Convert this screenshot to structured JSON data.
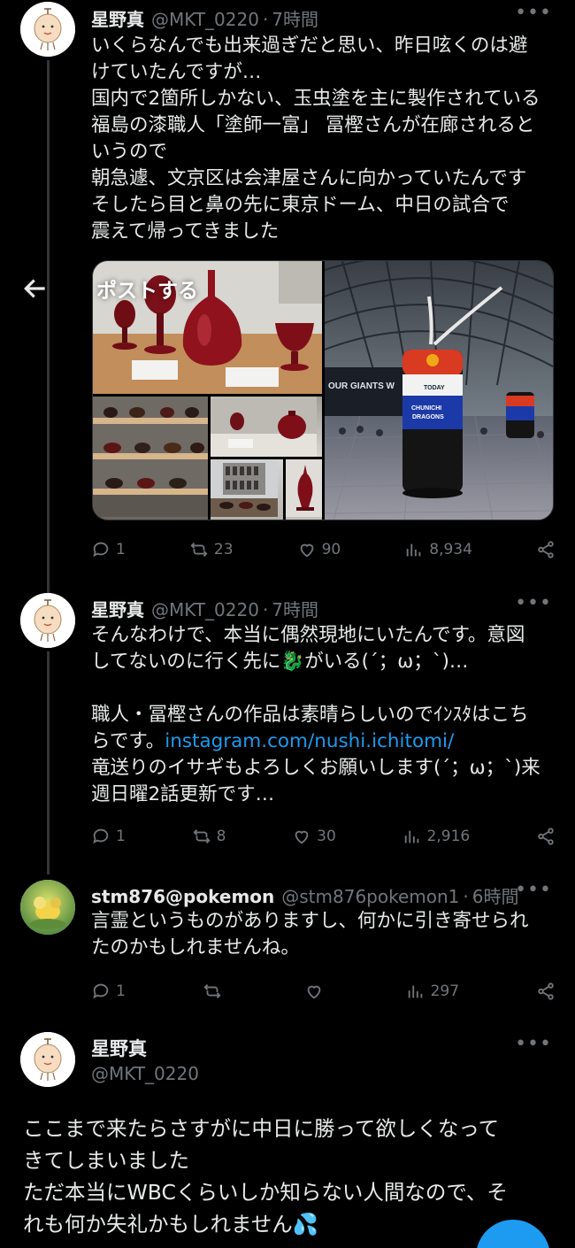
{
  "nav": {
    "back_icon": "arrow-left-icon"
  },
  "tweets": [
    {
      "name": "星野真",
      "handle": "@MKT_0220",
      "time": "7時間",
      "lines": [
        "いくらなんでも出来過ぎだと思い、昨日呟くのは避",
        "けていたんですが…",
        "国内で2箇所しかない、玉虫塗を主に製作されている",
        "福島の漆職人「塗師一富」 冨樫さんが在廊されると",
        "いうので",
        "朝急遽、文京区は会津屋さんに向かっていたんです",
        "そしたら目と鼻の先に東京ドーム、中日の試合で",
        "震えて帰ってきました"
      ],
      "media_overlay": "ポストする",
      "media_texts": {
        "banner": "OUR GIANTS W",
        "pillar_top": "TODAY",
        "pillar_1": "CHUNICHI",
        "pillar_2": "DRAGONS"
      },
      "actions": {
        "replies": "1",
        "reposts": "23",
        "likes": "90",
        "views": "8,934"
      }
    },
    {
      "name": "星野真",
      "handle": "@MKT_0220",
      "time": "7時間",
      "lines": [
        "そんなわけで、本当に偶然現地にいたんです。意図",
        "してないのに行く先に🐉がいる(´；ω；`)…",
        "",
        "職人・冨樫さんの作品は素晴らしいのでｲﾝｽﾀはこち",
        "らです。"
      ],
      "link": "instagram.com/nushi.ichitomi/",
      "lines_after": [
        "竜送りのイサギもよろしくお願いします(´；ω；`)来",
        "週日曜2話更新です…"
      ],
      "actions": {
        "replies": "1",
        "reposts": "8",
        "likes": "30",
        "views": "2,916"
      }
    },
    {
      "name": "stm876@pokemon",
      "handle": "@stm876pokemon1",
      "time": "6時間",
      "lines": [
        "言霊というものがありますし、何かに引き寄せられ",
        "たのかもしれませんね。"
      ],
      "actions": {
        "replies": "1",
        "reposts": "",
        "likes": "",
        "views": "297"
      }
    },
    {
      "name": "星野真",
      "handle": "@MKT_0220",
      "lines": [
        "ここまで来たらさすがに中日に勝って欲しくなって",
        "きてしまいました",
        "ただ本当にWBCくらいしか知らない人間なので、そ",
        "れも何か失礼かもしれません💦"
      ]
    }
  ],
  "more_label": "•••",
  "dot": "·",
  "colors": {
    "background": "#000000",
    "text": "#e7e9ea",
    "muted": "#71767b",
    "link": "#1d9bf0",
    "thread_line": "#333639"
  }
}
